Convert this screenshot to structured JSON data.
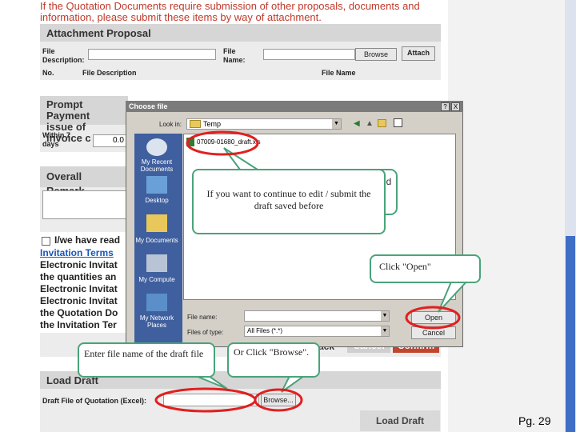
{
  "notice": {
    "line1": "If the Quotation Documents require submission of other proposals, documents and",
    "line2": "information, please submit these items by way of attachment."
  },
  "attachment": {
    "title": "Attachment Proposal",
    "file_desc_label_1": "File",
    "file_desc_label_2": "Description:",
    "file_name_label_1": "File",
    "file_name_label_2": "Name:",
    "browse_label": "Browse",
    "attach_label": "Attach",
    "col_no": "No.",
    "col_desc": "File Description",
    "col_name": "File Name"
  },
  "payment": {
    "title_1": "Prompt Payment",
    "title_2": "issue of invoice c",
    "row_label_1": "Within 7",
    "row_label_2": "days",
    "row_value": "0.0"
  },
  "remark": {
    "title": "Overall Remark"
  },
  "terms": {
    "line1": "I/we have read",
    "line2": "Invitation Terms",
    "line3": "Electronic Invitat",
    "line4": "the quantities an",
    "line5": "Electronic Invitat",
    "line6": "Electronic Invitat",
    "line7": "the Quotation Do",
    "line8": "the Invitation Ter"
  },
  "bottom_buttons": {
    "b1": "ack",
    "b2": "Cancel",
    "b3": "Confirm"
  },
  "load_draft": {
    "title": "Load Draft",
    "field_label": "Draft File of Quotation (Excel):",
    "browse_label": "Browse...",
    "button_label": "Load Draft"
  },
  "dialog": {
    "title": "Choose file",
    "help": "?",
    "close": "X",
    "look_in_label": "Look in:",
    "look_in_value": "Temp",
    "file_item": "07009-01680_draft.xls",
    "places": {
      "recent_1": "My Recent",
      "recent_2": "Documents",
      "desktop": "Desktop",
      "mydocs": "My Documents",
      "computer": "My Compute",
      "network_1": "My Network",
      "network_2": "Places"
    },
    "file_name_label": "File name:",
    "files_type_label": "Files of type:",
    "files_type_value": "All Files (*.*)",
    "open_label": "Open",
    "cancel_label": "Cancel"
  },
  "callouts": {
    "continue": "If you want to continue to edit / submit the draft saved before",
    "partial": "ed",
    "open": "Click \"Open\"",
    "enter": "Enter file name of the draft file",
    "browse": "Or Click \"Browse\"."
  },
  "page_number": "Pg. 29",
  "colors": {
    "highlight_red": "#e02020",
    "callout_border": "#4aa37a",
    "confirm_red": "#c0472f",
    "link_blue": "#1a56b8"
  }
}
